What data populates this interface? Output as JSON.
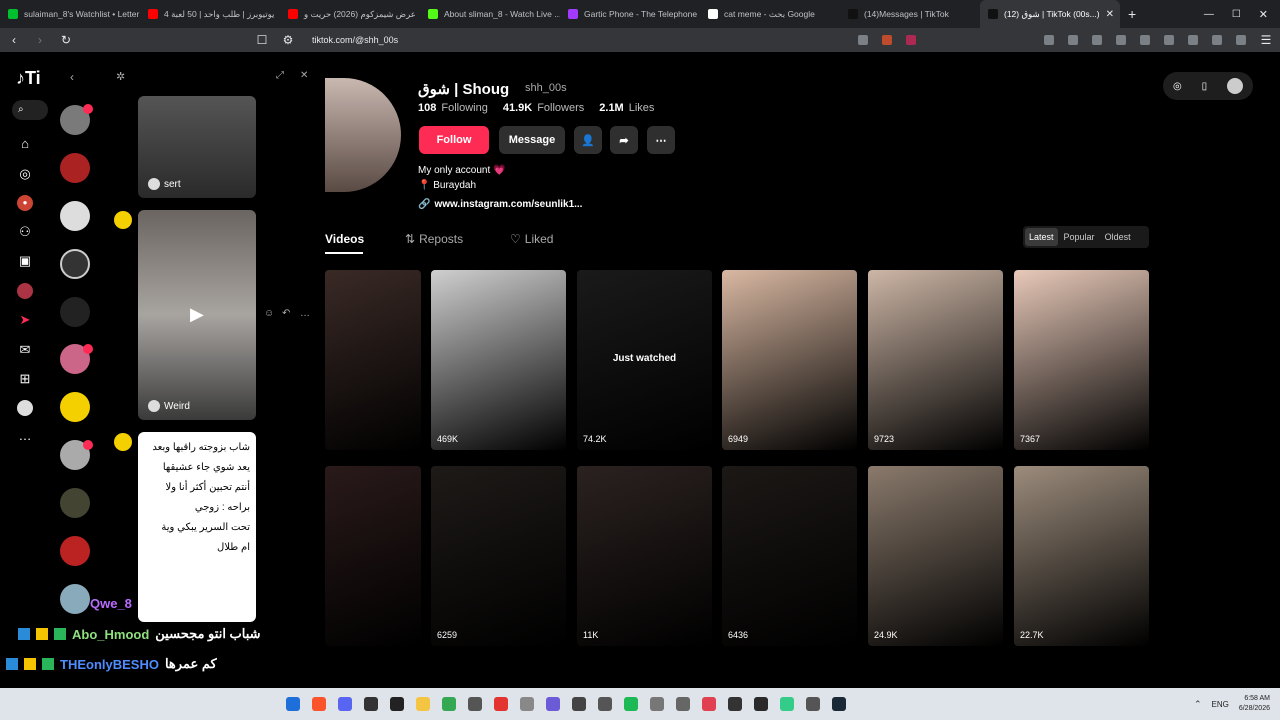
{
  "browser": {
    "tabs": [
      {
        "label": "sulaiman_8's Watchlist • Letter",
        "fav": "#00c030",
        "active": false
      },
      {
        "label": "4 يوتيوبرز | طلب واحد | 50 لعبة",
        "fav": "#ff0000",
        "active": false
      },
      {
        "label": "عرض شيمزكوم (2026) حريت و",
        "fav": "#ff0000",
        "active": false
      },
      {
        "label": "About sliman_8 - Watch Live ...",
        "fav": "#53fc18",
        "active": false
      },
      {
        "label": "Gartic Phone - The Telephone",
        "fav": "#a33aff",
        "active": false
      },
      {
        "label": "cat meme - بحث Google",
        "fav": "#ffffff",
        "active": false
      },
      {
        "label": "(14)Messages | TikTok",
        "fav": "#111111",
        "active": false
      },
      {
        "label": "(12) شوق | TikTok (00s...)",
        "fav": "#111111",
        "active": true
      }
    ],
    "url": "tiktok.com/@shh_00s"
  },
  "chat": {
    "cards": [
      {
        "name": "sert"
      },
      {
        "name": "Weird"
      }
    ],
    "arabic_text": [
      "شاب بزوجته راقبها وبعد",
      "يعد شوي جاء عشيقها",
      "أنتم تحبين أكثر أنا ولا",
      "براحه : زوجي",
      "تحت السرير يبكي وية",
      "ام طلال"
    ]
  },
  "stream_chat": [
    {
      "user": "Qwe_8",
      "text": ""
    },
    {
      "user": "Abo_Hmood",
      "text": "شباب انتو مجحسين"
    },
    {
      "user": "THEonlyBESHO",
      "text": "كم عمرها"
    }
  ],
  "profile": {
    "name": "شوق | Shoug",
    "handle": "shh_00s",
    "following_count": "108",
    "following_label": "Following",
    "followers_count": "41.9K",
    "followers_label": "Followers",
    "likes_count": "2.1M",
    "likes_label": "Likes",
    "follow_label": "Follow",
    "message_label": "Message",
    "bio_line1": "My only account 💗",
    "bio_line2": "📍 Buraydah",
    "link": "www.instagram.com/seunlik1...",
    "tabs": [
      "Videos",
      "Reposts",
      "Liked"
    ],
    "sort": [
      "Latest",
      "Popular",
      "Oldest"
    ],
    "just_watched": "Just watched",
    "videos_row1": [
      {
        "views": "",
        "color": "#3a2a26"
      },
      {
        "views": "469K",
        "color": "#cfcfcf"
      },
      {
        "views": "74.2K",
        "color": "#1a1a1a"
      },
      {
        "views": "6949",
        "color": "#d9b8a2"
      },
      {
        "views": "9723",
        "color": "#cdb6a6"
      },
      {
        "views": "7367",
        "color": "#e8c9b9"
      }
    ],
    "videos_row2": [
      {
        "views": "",
        "color": "#2a1a1a"
      },
      {
        "views": "6259",
        "color": "#1e1a18"
      },
      {
        "views": "11K",
        "color": "#2b2220"
      },
      {
        "views": "6436",
        "color": "#1c1816"
      },
      {
        "views": "24.9K",
        "color": "#8a7a6c"
      },
      {
        "views": "22.7K",
        "color": "#9c8c7c"
      }
    ]
  },
  "taskbar": {
    "lang": "ENG",
    "time": "6:58 AM",
    "date": "6/28/2026"
  }
}
